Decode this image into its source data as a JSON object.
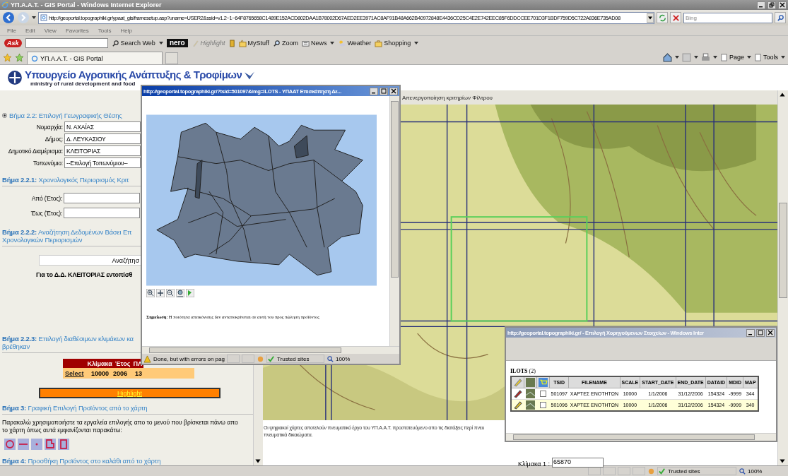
{
  "browser": {
    "title": "ΥΠ.Α.Α.Τ. - GIS Portal - Windows Internet Explorer",
    "address": "http://geoportal.topographiki.gr/ypaat_gis/framesetup.asp?uname=USER2&ssid=v1.2~1~64F8765658C1489E152ACD802DAA1B78002D67AED2EE3971AC8AF91B48A662B40972848E4436CD25C4E2E742EEC85F6DDCCEE701D3F1BDF759D5C722A836E735AD08",
    "search_placeholder": "Bing",
    "menu": [
      "File",
      "Edit",
      "View",
      "Favorites",
      "Tools",
      "Help"
    ],
    "ask_logo": "Ask",
    "toolbar": [
      {
        "label": "Search Web",
        "kind": "search",
        "disabled": false
      },
      {
        "label": "nero",
        "kind": "logo",
        "disabled": false
      },
      {
        "label": "Highlight",
        "kind": "highlight",
        "disabled": true
      },
      {
        "label": "MyStuff",
        "kind": "mystuff",
        "disabled": false
      },
      {
        "label": "Zoom",
        "kind": "zoom",
        "disabled": false
      },
      {
        "label": "News",
        "kind": "news",
        "disabled": false
      },
      {
        "label": "Weather",
        "kind": "weather",
        "disabled": false
      },
      {
        "label": "Shopping",
        "kind": "shopping",
        "disabled": false
      }
    ],
    "tab": "ΥΠ.Α.Α.Τ. - GIS Portal",
    "command_bar": [
      "Page",
      "Tools"
    ]
  },
  "header": {
    "title": "Υπουργείο Αγροτικής Ανάπτυξης & Τροφίμων",
    "subtitle": "ministry of rural development and food"
  },
  "left_panel": {
    "location_step": {
      "text": "Βήμα 2.2: Επιλογή Γεωγραφικής Θέσης",
      "selected": true
    },
    "location_fields": [
      {
        "label": "Νομαρχία:",
        "value": "Ν. ΑΧΑΪΑΣ"
      },
      {
        "label": "Δήμος:",
        "value": "Δ. ΛΕΥΚΑΣΙΟΥ"
      },
      {
        "label": "Δημοτικό Διαμέρισμα:",
        "value": "ΚΛΕΙΤΟΡΙΑΣ"
      },
      {
        "label": "Τοπωνύμιο:",
        "value": "--Επιλογή Τοπωνύμιου--"
      }
    ],
    "time_step": [
      "**Βήμα 2.2.1:** Χρονολογικός Περιορισμός Κριτ"
    ],
    "year_fields": [
      {
        "label": "Από (Έτος):"
      },
      {
        "label": "Έως (Έτος):"
      }
    ],
    "search_step": [
      "**Βήμα 2.2.2:** Αναζήτηση Δεδομένων Βάσει Επ",
      "Χρονολογικών Περιορισμών"
    ],
    "search_button": "Αναζήτησ",
    "result": "Για το Δ.Δ. ΚΛΕΙΤΟΡΙΑΣ εντοπίσθ",
    "scale_step": [
      "**Βήμα 2.2.3:** Επιλογή διαθέσιμων κλιμάκων κα",
      "βρέθηκαν"
    ],
    "scales_table": {
      "columns": [
        "Κλίμακα",
        "Έτος",
        "ΠΛ"
      ],
      "rows": [
        {
          "link": "Select",
          "cells": [
            "10000",
            "2006",
            "13"
          ]
        }
      ]
    },
    "highlight_button": "Highlight",
    "map_step": [
      "**Βήμα 3:** Γραφική Επιλογή Προϊόντος από το χάρτη"
    ],
    "instructions": "Παρακαλώ χρησιμοποιήστε τα εργαλεία επιλογής απο το μενού που βρίσκεται πάνω απο το χάρτη όπως αυτά εμφανίζονται παρακάτω:",
    "cart_step": [
      "**Βήμα 4:** Προσθήκη Προϊόντος στο καλάθι από το χάρτη"
    ]
  },
  "map": {
    "filter_link": "Απενεργοποίηση κριτηρίων Φίλτρου",
    "copyright": [
      "Οι ψηφιακοί χάρτες αποτελούν πνευματικό έργο του ΥΠ.Α.Α.Τ. προστατευόμενο απο τις διατάξεις περί πνευ",
      "πνευματικά δικαιώματα."
    ],
    "scale_label": "Κλίμακα 1 :",
    "scale_value": "65870"
  },
  "map_popup": {
    "title": "http://geoportal.topographiki.gr/?tsid=501097&img=ILOTS - ΥΠΑΑΤ Επισκόπηση Δε...",
    "note": "**Σημείωση**: Η ποιότητα απεικόνισης δεν ανταποκρίνεται σε αυτή του προς πώληση προϊόντος",
    "status": "Done, but with errors on pag",
    "zone": "Trusted sites",
    "zoom": "100%"
  },
  "table_popup": {
    "title": "http://geoportal.topographiki.gr/ - Επιλογή Χορηγούμενων Στοιχείων - Windows Inter",
    "caption": "**ILOTS** (2)",
    "columns": [
      "TSID",
      "FILENAME",
      "SCALE",
      "START_DATE",
      "END_DATE",
      "DATAID",
      "MDID",
      "MAP"
    ],
    "rows": [
      {
        "cells": [
          "501097",
          "ΧΑΡΤΕΣ ΕΝΟΤΗΤΩΝ",
          "10000",
          "1/1/2006",
          "31/12/2006",
          "154324",
          "-9999",
          "344"
        ],
        "selected": false,
        "editing": true,
        "checked": false
      },
      {
        "cells": [
          "501096",
          "ΧΑΡΤΕΣ ΕΝΟΤΗΤΩΝ",
          "10000",
          "1/1/2006",
          "31/12/2006",
          "154324",
          "-9999",
          "340"
        ],
        "selected": true,
        "editing": false,
        "checked": false
      }
    ]
  },
  "status_bar": {
    "zone": "Trusted sites",
    "zoom": "100%"
  }
}
